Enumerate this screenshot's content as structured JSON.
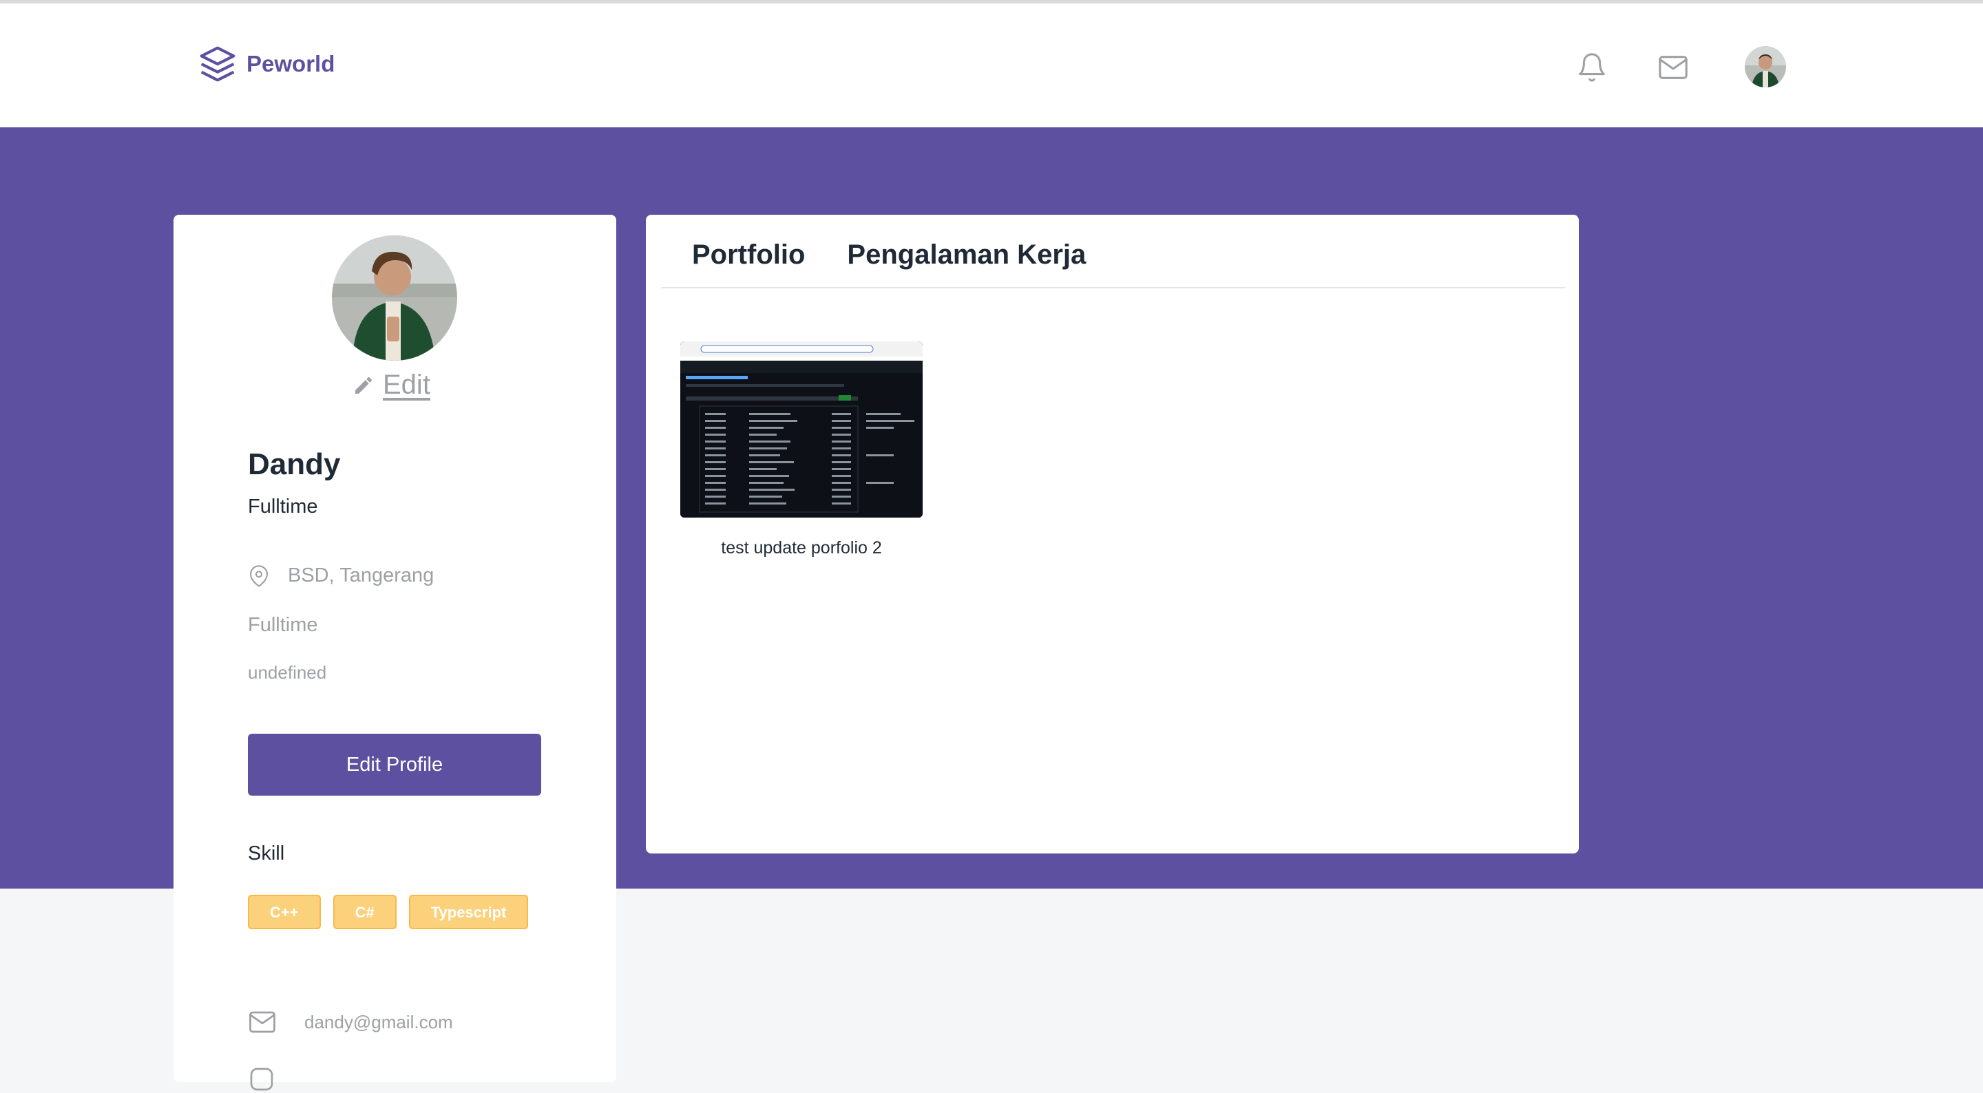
{
  "brand": {
    "name": "Peworld",
    "color": "#5e50a1"
  },
  "nav": {
    "notification_icon": "bell-icon",
    "message_icon": "mail-icon",
    "avatar": "user-avatar"
  },
  "profile": {
    "photo": "profile-photo",
    "edit_photo_label": "Edit",
    "name": "Dandy",
    "job": "Fulltime",
    "location": "BSD, Tangerang",
    "work_type": "Fulltime",
    "description": "undefined",
    "edit_button_label": "Edit Profile",
    "skill_title": "Skill",
    "skills": [
      "C++",
      "C#",
      "Typescript"
    ],
    "email": "dandy@gmail.com"
  },
  "tabs": [
    {
      "label": "Portfolio"
    },
    {
      "label": "Pengalaman Kerja"
    }
  ],
  "portfolio": [
    {
      "title": "test update porfolio 2"
    }
  ],
  "colors": {
    "accent": "#5e50a1",
    "skill_tag": "#fbd17b",
    "background": "#f5f6f8"
  }
}
